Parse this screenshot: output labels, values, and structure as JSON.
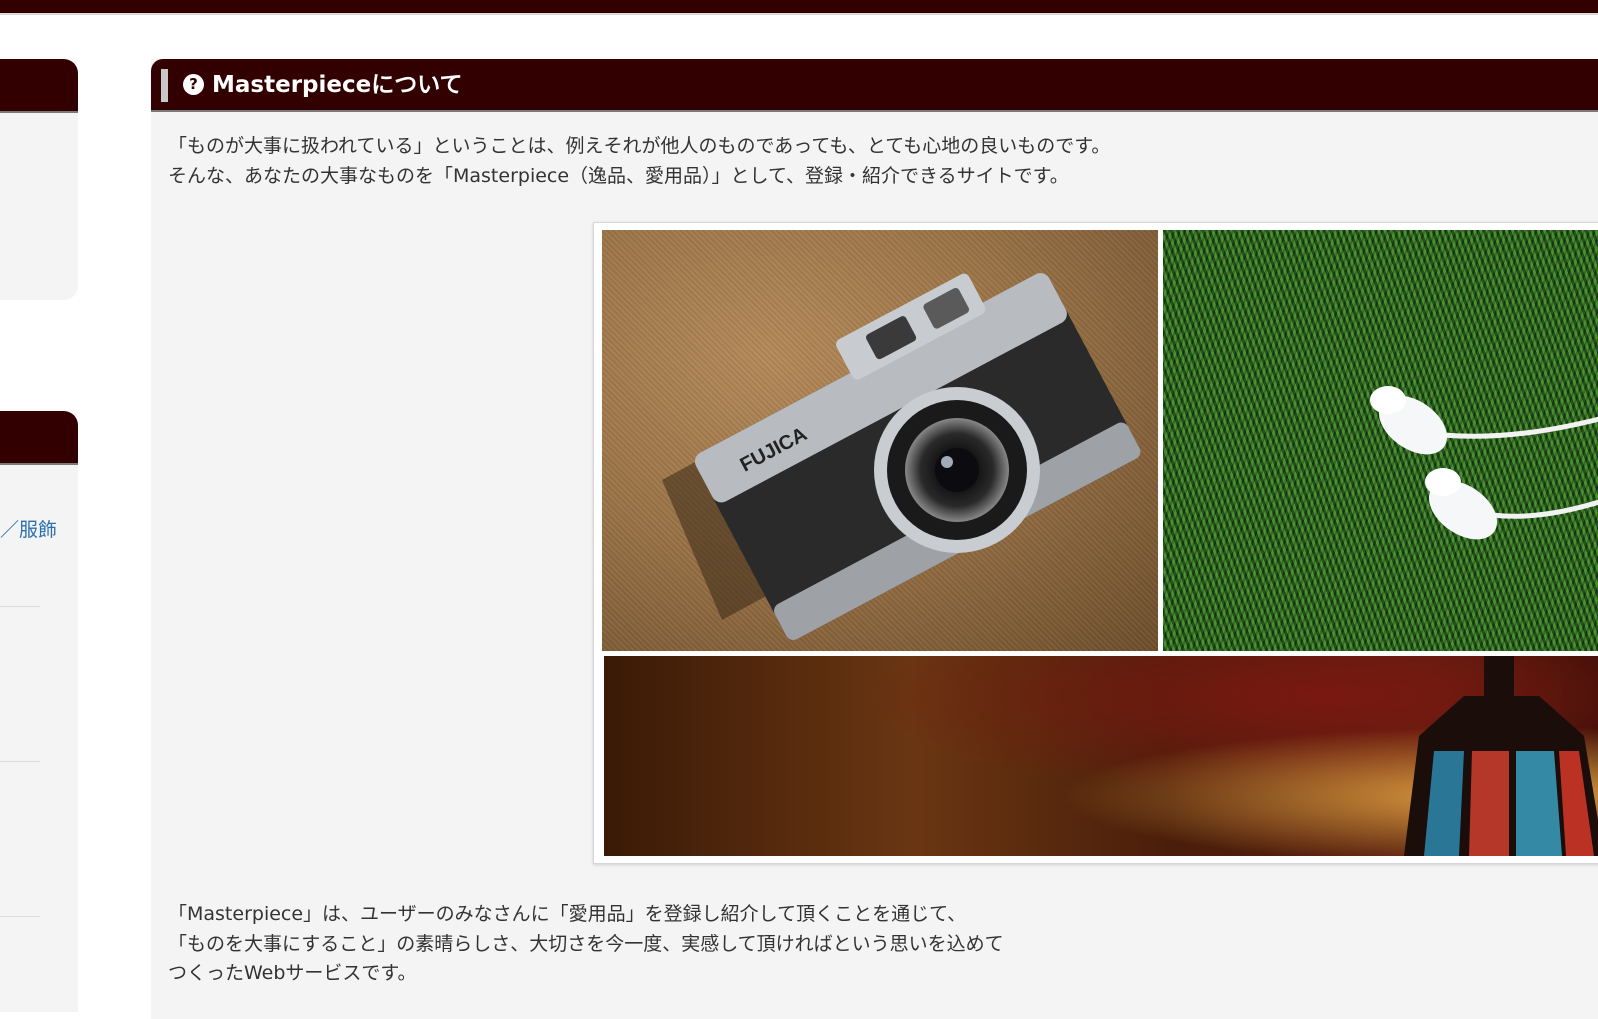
{
  "colors": {
    "header_bg": "#320000",
    "panel_bg": "#f4f4f4",
    "link": "#2a6fb0",
    "text": "#333333"
  },
  "sidebar": {
    "link_partial": "／服飾"
  },
  "main": {
    "icon": "help-circle-icon",
    "title": "Masterpieceについて",
    "intro_lines": [
      "「ものが大事に扱われている」ということは、例えそれが他人のものであっても、とても心地の良いものです。",
      "そんな、あなたの大事なものを「Masterpiece（逸品、愛用品）」として、登録・紹介できるサイトです。"
    ],
    "collage_images": [
      "camera-photo",
      "earphones-on-grass-photo",
      "lantern-photo"
    ],
    "body_lines": [
      "「Masterpiece」は、ユーザーのみなさんに「愛用品」を登録し紹介して頂くことを通じて、",
      "「ものを大事にすること」の素晴らしさ、大切さを今一度、実感して頂ければという思いを込めて",
      "つくったWebサービスです。"
    ]
  }
}
